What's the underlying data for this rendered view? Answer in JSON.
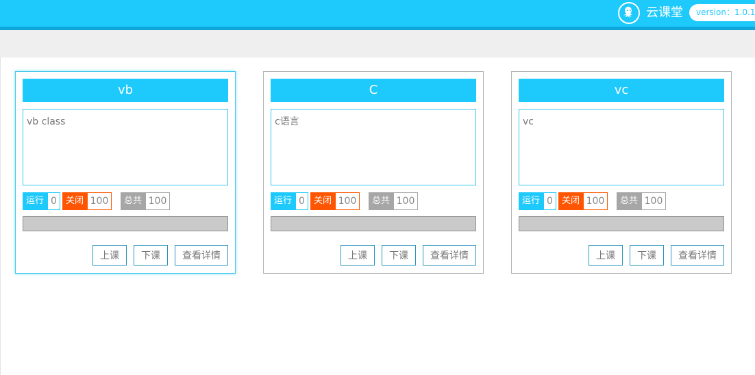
{
  "header": {
    "brand_name": "云课堂",
    "version_label": "version：1.0.1",
    "logo_icon": "octopus-icon",
    "accent_color": "#1ec9fc"
  },
  "stat_labels": {
    "running": "运行",
    "closed": "关闭",
    "total": "总共"
  },
  "button_labels": {
    "start": "上课",
    "end": "下课",
    "details": "查看详情"
  },
  "colors": {
    "running": "#1ec9fc",
    "closed": "#ff5500",
    "total": "#a6a6a6",
    "progress_track": "#cacaca"
  },
  "courses": [
    {
      "title": "vb",
      "description": "vb class",
      "running": "0",
      "closed": "100",
      "total": "100",
      "progress": 0,
      "selected": true
    },
    {
      "title": "C",
      "description": "c语言",
      "running": "0",
      "closed": "100",
      "total": "100",
      "progress": 0,
      "selected": false
    },
    {
      "title": "vc",
      "description": "vc",
      "running": "0",
      "closed": "100",
      "total": "100",
      "progress": 0,
      "selected": false
    }
  ]
}
